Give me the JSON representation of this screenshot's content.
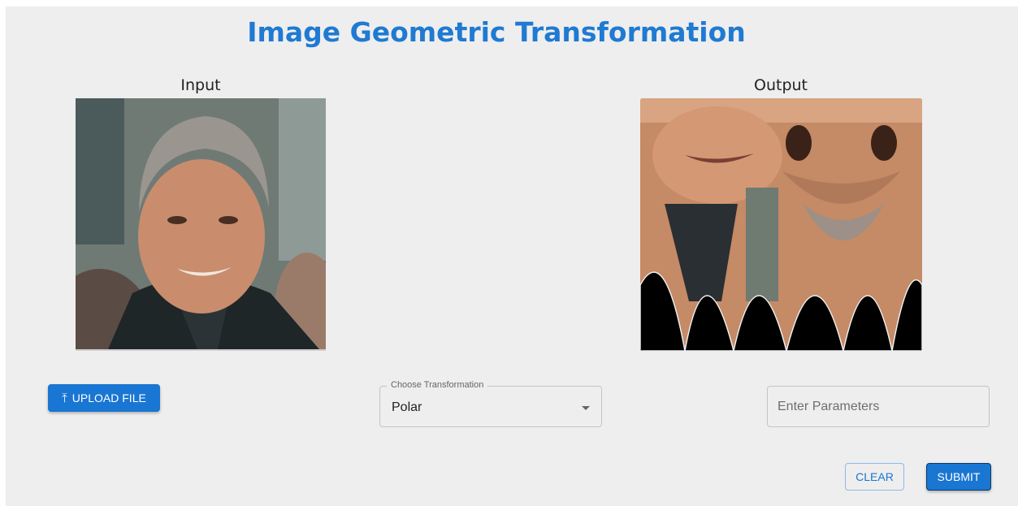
{
  "header": {
    "title": "Image Geometric Transformation"
  },
  "input_panel": {
    "label": "Input"
  },
  "output_panel": {
    "label": "Output"
  },
  "upload": {
    "label": "UPLOAD FILE",
    "icon": "upload-icon"
  },
  "transformation": {
    "legend": "Choose Transformation",
    "selected": "Polar",
    "icon": "chevron-down-icon"
  },
  "parameters": {
    "placeholder": "Enter Parameters",
    "value": ""
  },
  "actions": {
    "clear_label": "CLEAR",
    "submit_label": "SUBMIT"
  },
  "colors": {
    "accent": "#1976d2",
    "title": "#1f7ad2",
    "background": "#eeeeee"
  }
}
